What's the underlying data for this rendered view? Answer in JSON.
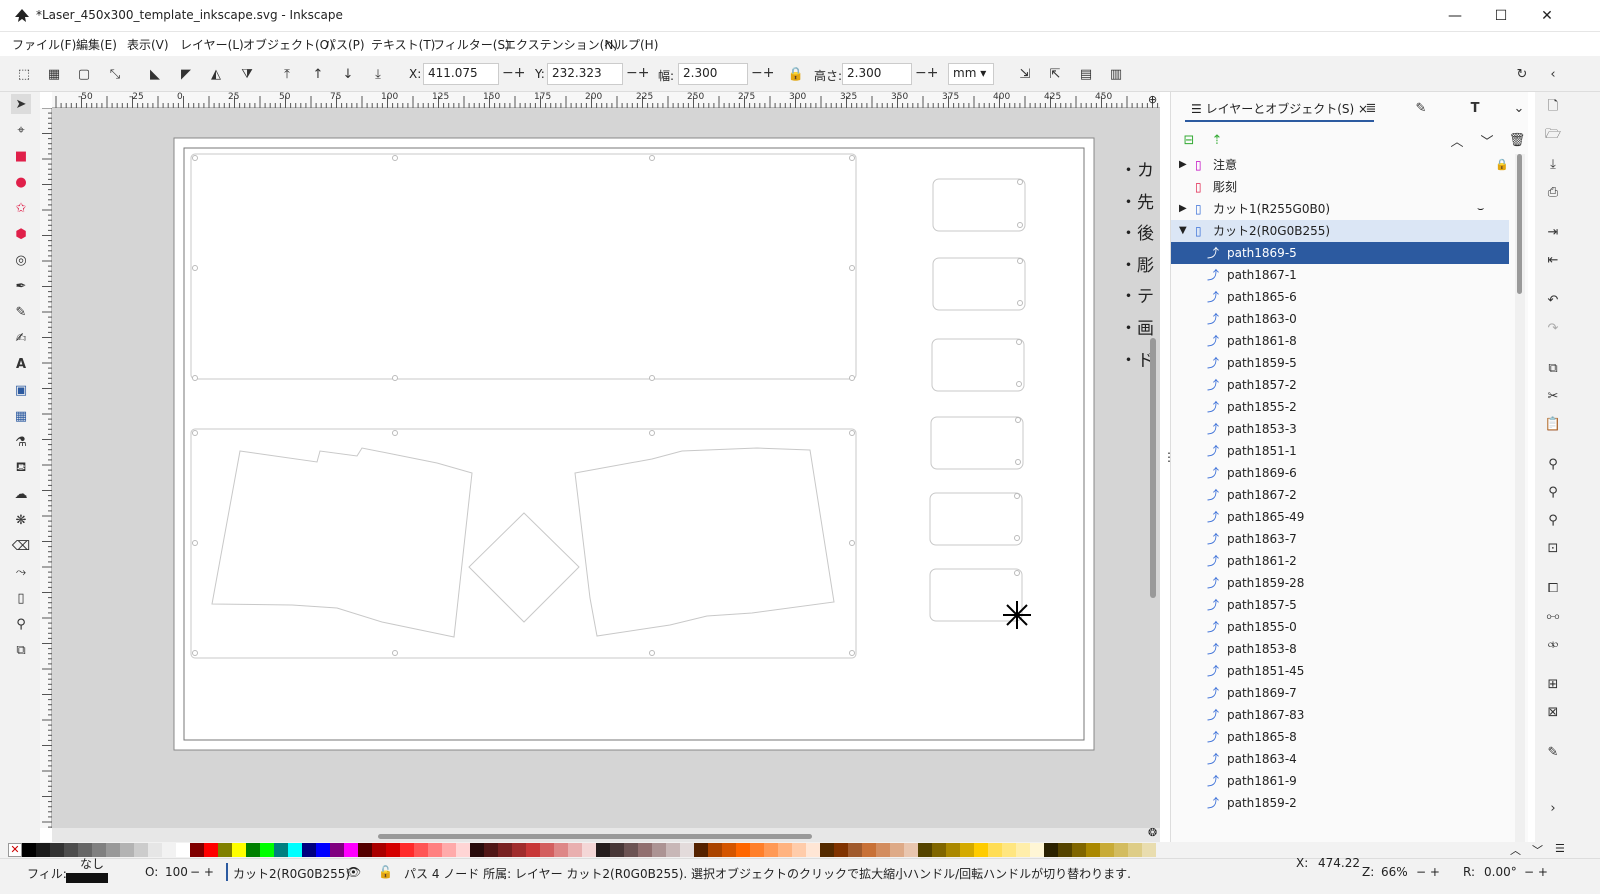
{
  "window": {
    "title": "*Laser_450x300_template_inkscape.svg - Inkscape",
    "minimize": "—",
    "maximize": "☐",
    "close": "✕"
  },
  "menu": [
    "ファイル(F)",
    "編集(E)",
    "表示(V)",
    "レイヤー(L)",
    "オブジェクト(O)",
    "パス(P)",
    "テキスト(T)",
    "フィルター(S)",
    "エクステンション(N)",
    "ヘルプ(H)"
  ],
  "toolbar": {
    "x_label": "X:",
    "x_value": "411.075",
    "y_label": "Y:",
    "y_value": "232.323",
    "w_label": "幅:",
    "w_value": "2.300",
    "h_label": "高さ:",
    "h_value": "2.300",
    "unit": "mm"
  },
  "ruler": [
    "-50",
    "-25",
    "0",
    "25",
    "50",
    "75",
    "100",
    "125",
    "150",
    "175",
    "200",
    "225",
    "250",
    "275",
    "300",
    "325",
    "350",
    "375",
    "400",
    "425",
    "450"
  ],
  "side_text": [
    "・カ",
    "・先",
    "・後",
    "・彫",
    "・テ",
    "・画",
    "・ド"
  ],
  "panel": {
    "tab": "レイヤーとオブジェクト(S)",
    "tab_close": "×",
    "layers": [
      {
        "label": "注意",
        "color": "#c000c0"
      },
      {
        "label": "彫刻",
        "color": "#e0204a"
      },
      {
        "label": "カット1(R255G0B0)",
        "color": "#3a6fd8"
      },
      {
        "label": "カット2(R0G0B255)",
        "color": "#3a6fd8"
      }
    ],
    "paths": [
      "path1869-5",
      "path1867-1",
      "path1865-6",
      "path1863-0",
      "path1861-8",
      "path1859-5",
      "path1857-2",
      "path1855-2",
      "path1853-3",
      "path1851-1",
      "path1869-6",
      "path1867-2",
      "path1865-49",
      "path1863-7",
      "path1861-2",
      "path1859-28",
      "path1857-5",
      "path1855-0",
      "path1853-8",
      "path1851-45",
      "path1869-7",
      "path1867-83",
      "path1865-8",
      "path1863-4",
      "path1861-9",
      "path1859-2"
    ]
  },
  "status": {
    "fill_label": "フィル:",
    "fill_value": "なし",
    "o_label": "O:",
    "o_value": "100",
    "layer": "カット2(R0G0B255)",
    "message": "パス 4 ノード 所属: レイヤー カット2(R0G0B255). 選択オブジェクトのクリックで拡大縮小ハンドル/回転ハンドルが切り替わります.",
    "cx_label": "X:",
    "cx_value": "474.22",
    "z_label": "Z:",
    "z_value": "66%",
    "r_label": "R:",
    "r_value": "0.00°"
  },
  "palette": [
    "#000000",
    "#1a1a1a",
    "#333333",
    "#4d4d4d",
    "#666666",
    "#808080",
    "#999999",
    "#b3b3b3",
    "#cccccc",
    "#e6e6e6",
    "#f2f2f2",
    "#ffffff",
    "#800000",
    "#ff0000",
    "#808000",
    "#ffff00",
    "#008000",
    "#00ff00",
    "#008080",
    "#00ffff",
    "#000080",
    "#0000ff",
    "#800080",
    "#ff00ff",
    "#550000",
    "#aa0000",
    "#d40000",
    "#ff2a2a",
    "#ff5555",
    "#ff8080",
    "#ffaaaa",
    "#ffd5d5",
    "#280b0b",
    "#501616",
    "#782121",
    "#a02c2c",
    "#c83737",
    "#d35f5f",
    "#de8787",
    "#e9afaf",
    "#f4d7d7",
    "#241c1c",
    "#483737",
    "#6c5353",
    "#916f6f",
    "#ac9393",
    "#c8b7b7",
    "#e3dbdb",
    "#552200",
    "#aa4400",
    "#d45500",
    "#ff6600",
    "#ff7f2a",
    "#ff9955",
    "#ffb380",
    "#ffccaa",
    "#ffe6d5",
    "#552b00",
    "#803300",
    "#a05a2c",
    "#c87137",
    "#d38d5f",
    "#deaa87",
    "#e9c6af",
    "#554400",
    "#806600",
    "#aa8800",
    "#d4aa00",
    "#ffcc00",
    "#ffdd55",
    "#ffe680",
    "#ffeeaa",
    "#fff6d5",
    "#2b2200",
    "#554400",
    "#806600",
    "#aa8800",
    "#c8ab37",
    "#d3bc5f",
    "#decd87",
    "#e9ddaf"
  ]
}
